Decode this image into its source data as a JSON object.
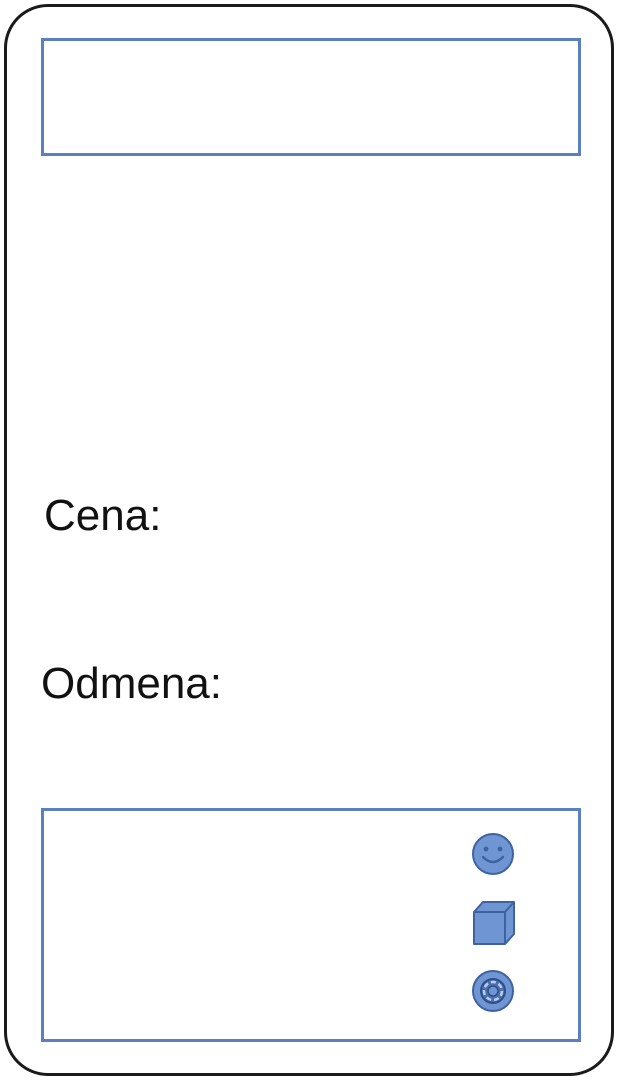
{
  "top_field": {
    "value": ""
  },
  "labels": {
    "price": "Cena:",
    "reward": "Odmena:"
  },
  "bottom_panel": {
    "icons": [
      "smiley-icon",
      "cube-icon",
      "ring-icon"
    ]
  },
  "colors": {
    "frame": "#1a1a1a",
    "accent": "#5b7fbf",
    "icon_fill": "#6f95d2"
  }
}
